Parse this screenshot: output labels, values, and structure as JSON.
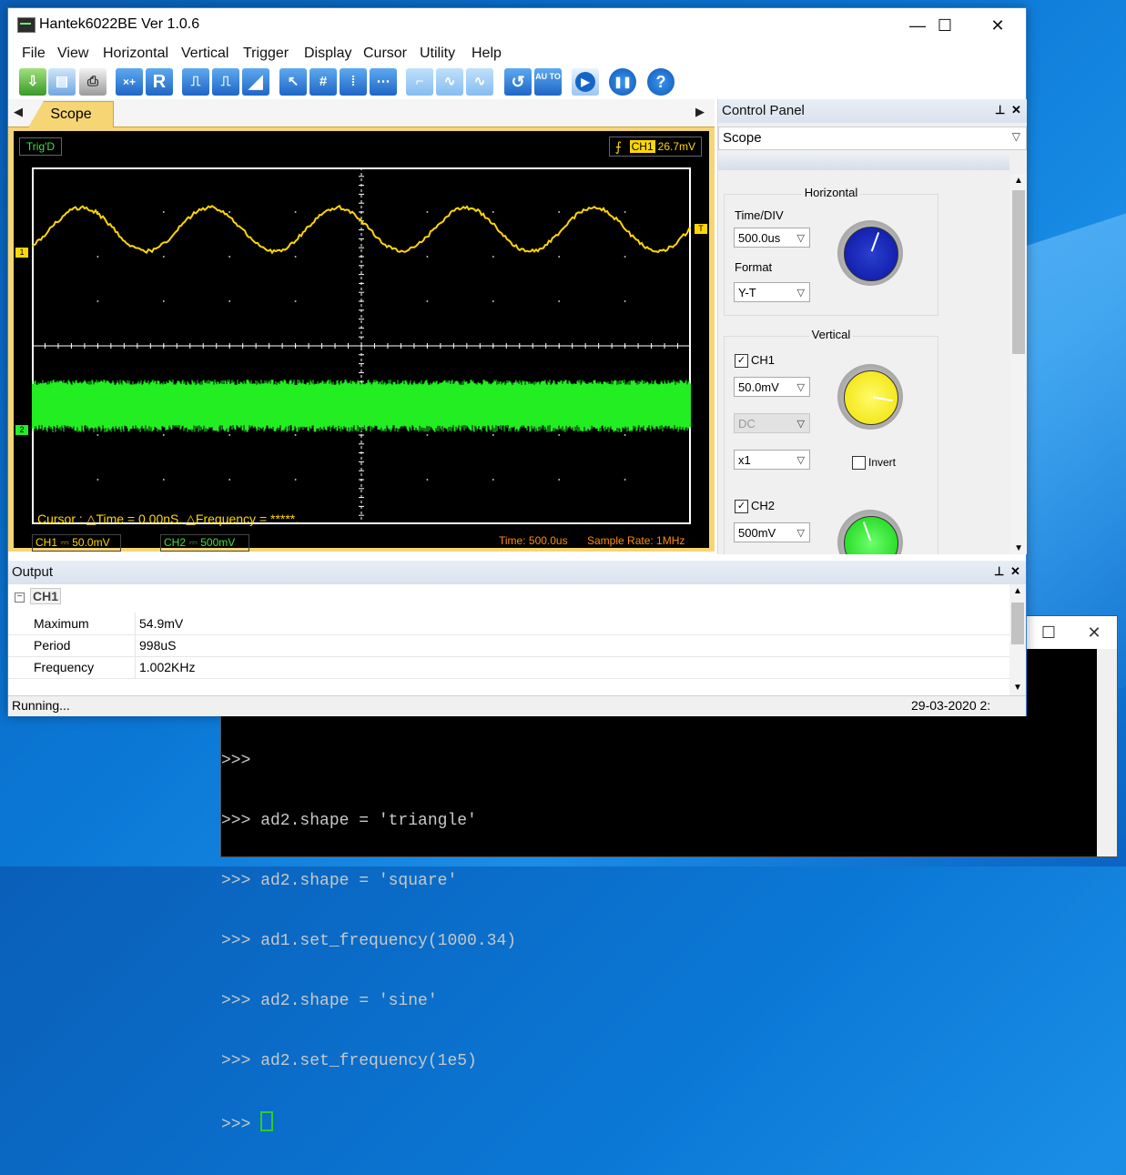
{
  "app": {
    "title": "Hantek6022BE Ver 1.0.6"
  },
  "window_buttons": {
    "minimize": "—",
    "maximize": "☐",
    "close": "✕"
  },
  "menu": [
    "File",
    "View",
    "Horizontal",
    "Vertical",
    "Trigger",
    "Display",
    "Cursor",
    "Utility",
    "Help"
  ],
  "toolbar": {
    "reset_label": "R",
    "auto_label": "AU TO",
    "icons": [
      "open-icon",
      "save-icon",
      "print-icon",
      "math-icon",
      "reference-icon",
      "pulse-icon",
      "pulse-width-icon",
      "ramp-icon",
      "cursor-icon",
      "grid-icon",
      "vertical-cursor-icon",
      "horizontal-cursor-icon",
      "square-wave-icon",
      "sine-wave-icon",
      "sine-wave-alt-icon",
      "refresh-icon",
      "auto-icon",
      "run-icon",
      "pause-icon",
      "help-icon"
    ]
  },
  "scope_tab": {
    "label": "Scope"
  },
  "scope": {
    "trig_status": "Trig'D",
    "trig_channel": "CH1",
    "trig_level": "26.7mV",
    "ch1_marker": "1",
    "ch2_marker": "2",
    "trig_marker": "T",
    "cursor_readout": "Cursor : △Time = 0.00nS. △Frequency = *****.",
    "ch1_status": "CH1 ⎓  50.0mV",
    "ch2_status": "CH2 ⎓  500mV",
    "time_status": "Time: 500.0us",
    "rate_status": "Sample Rate: 1MHz",
    "colors": {
      "ch1": "#ffd700",
      "ch2": "#22ee22",
      "grid": "#ffffff"
    }
  },
  "control_panel": {
    "title": "Control Panel",
    "selector": "Scope",
    "horizontal": {
      "title": "Horizontal",
      "time_div_label": "Time/DIV",
      "time_div": "500.0us",
      "format_label": "Format",
      "format": "Y-T"
    },
    "vertical": {
      "title": "Vertical",
      "ch1": {
        "label": "CH1",
        "checked": true,
        "volts": "50.0mV",
        "coupling": "DC",
        "probe": "x1",
        "invert_label": "Invert"
      },
      "ch2": {
        "label": "CH2",
        "checked": true,
        "volts": "500mV"
      }
    }
  },
  "output": {
    "title": "Output",
    "group": "CH1",
    "rows": [
      {
        "name": "Maximum",
        "value": "54.9mV"
      },
      {
        "name": "Period",
        "value": "998uS"
      },
      {
        "name": "Frequency",
        "value": "1.002KHz"
      }
    ]
  },
  "statusbar": {
    "left": "Running...",
    "right": "29-03-2020  2:"
  },
  "terminal": {
    "lines": [
      ">>>",
      ">>> ad2.shape = 'triangle'",
      ">>> ad2.shape = 'square'",
      ">>> ad1.set_frequency(1000.34)",
      ">>> ad2.shape = 'sine'",
      ">>> ad2.set_frequency(1e5)"
    ],
    "prompt": ">>> "
  }
}
